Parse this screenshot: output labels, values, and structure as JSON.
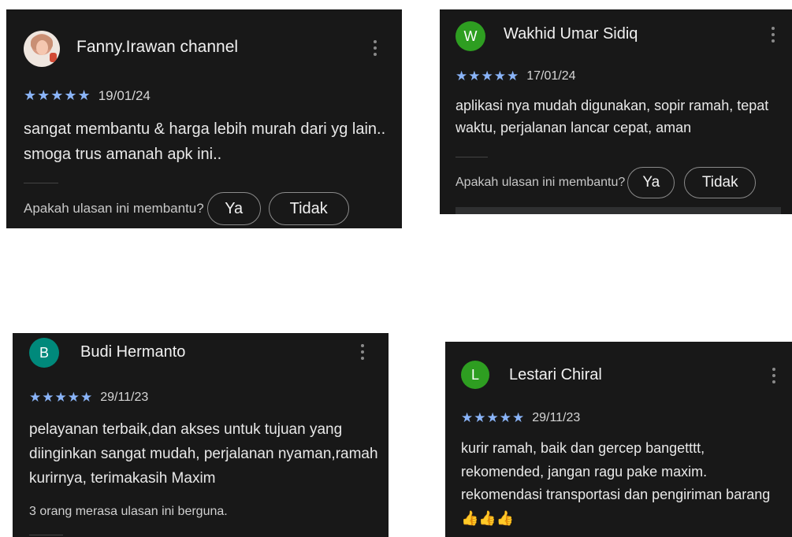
{
  "reviews": [
    {
      "name": "Fanny.Irawan channel",
      "stars": "★★★★★",
      "date": "19/01/24",
      "text": "sangat membantu & harga lebih murah dari yg lain.. smoga trus amanah apk ini..",
      "helpful_question": "Apakah ulasan ini membantu?",
      "yes_label": "Ya",
      "no_label": "Tidak"
    },
    {
      "name": "Wakhid Umar Sidiq",
      "avatar_letter": "W",
      "avatar_color": "#2e9e21",
      "stars": "★★★★★",
      "date": "17/01/24",
      "text": "aplikasi nya mudah digunakan, sopir ramah, tepat waktu, perjalanan lancar cepat, aman",
      "helpful_question": "Apakah ulasan ini membantu?",
      "yes_label": "Ya",
      "no_label": "Tidak"
    },
    {
      "name": "Budi Hermanto",
      "avatar_letter": "B",
      "avatar_color": "#00897b",
      "stars": "★★★★★",
      "date": "29/11/23",
      "text": "pelayanan terbaik,dan akses untuk tujuan yang diinginkan sangat mudah, perjalanan nyaman,ramah kurirnya, terimakasih Maxim",
      "helpful_count": "3 orang merasa ulasan ini berguna."
    },
    {
      "name": "Lestari Chiral",
      "avatar_letter": "L",
      "avatar_color": "#2e9e21",
      "stars": "★★★★★",
      "date": "29/11/23",
      "text": "kurir ramah, baik dan gercep bangetttt, rekomended, jangan ragu pake maxim. rekomendasi transportasi dan pengiriman barang",
      "emoji": "👍👍👍"
    }
  ]
}
